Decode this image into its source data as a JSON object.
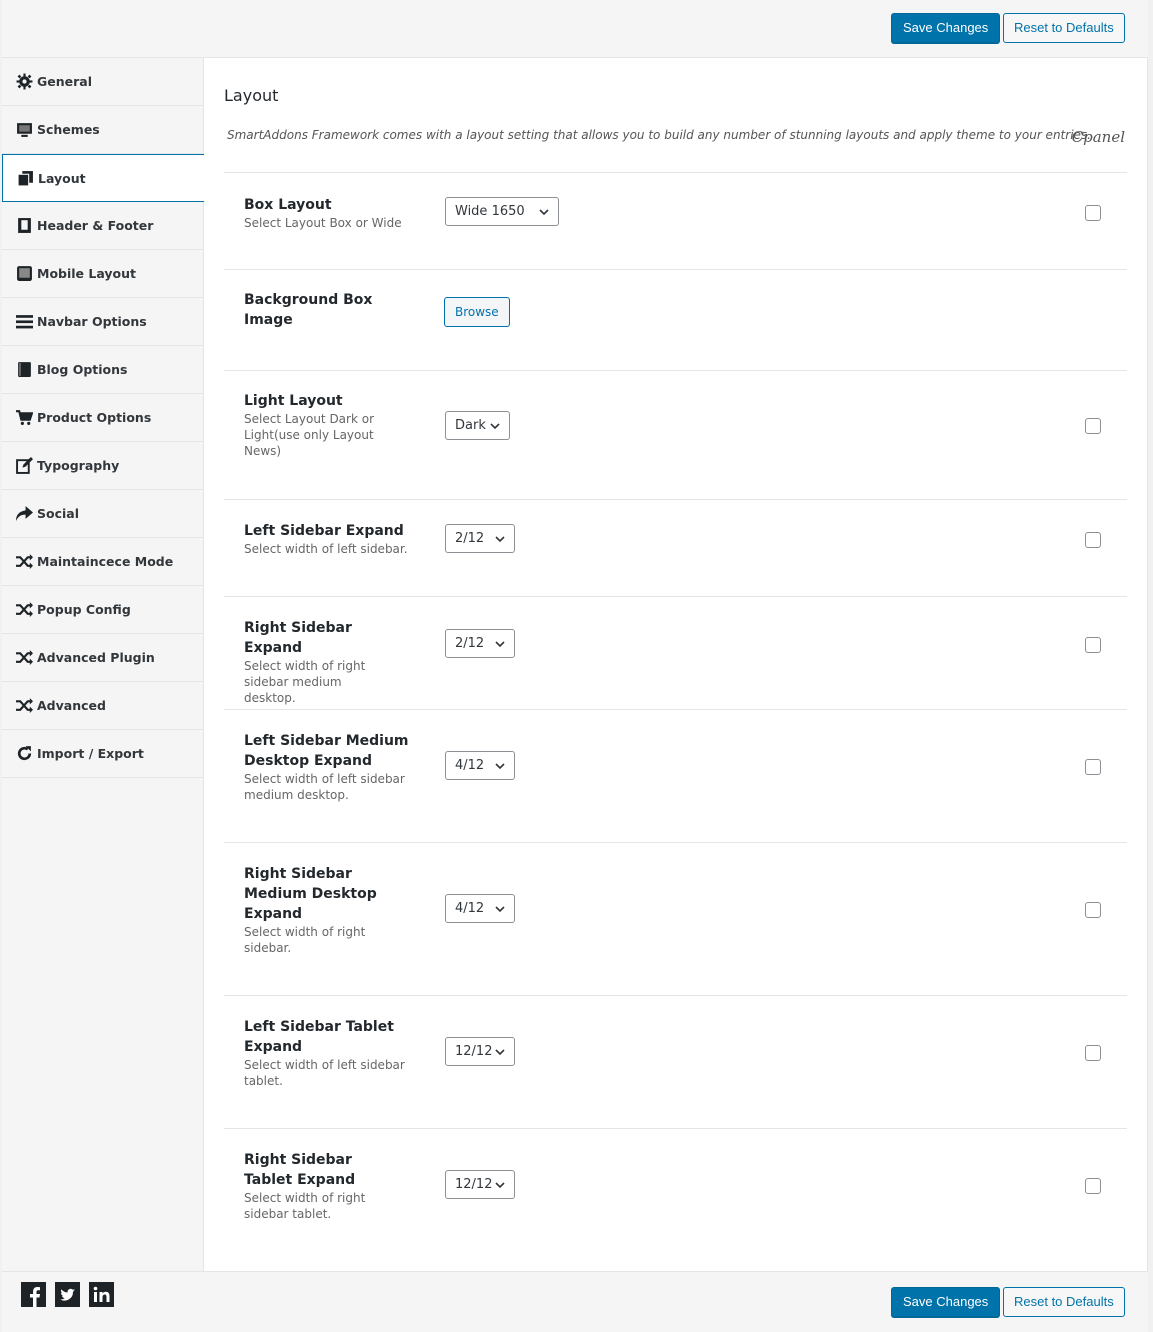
{
  "toolbar": {
    "save_label": "Save Changes",
    "reset_label": "Reset to Defaults"
  },
  "sidebar": {
    "items": [
      {
        "label": "General",
        "icon": "gear-icon"
      },
      {
        "label": "Schemes",
        "icon": "monitor-icon"
      },
      {
        "label": "Layout",
        "icon": "copy-icon",
        "active": true
      },
      {
        "label": "Header & Footer",
        "icon": "book-icon"
      },
      {
        "label": "Mobile Layout",
        "icon": "tablet-icon"
      },
      {
        "label": "Navbar Options",
        "icon": "menu-icon"
      },
      {
        "label": "Blog Options",
        "icon": "book-icon"
      },
      {
        "label": "Product Options",
        "icon": "cart-icon"
      },
      {
        "label": "Typography",
        "icon": "edit-icon"
      },
      {
        "label": "Social",
        "icon": "share-icon"
      },
      {
        "label": "Maintaincece Mode",
        "icon": "shuffle-icon"
      },
      {
        "label": "Popup Config",
        "icon": "shuffle-icon"
      },
      {
        "label": "Advanced Plugin",
        "icon": "shuffle-icon"
      },
      {
        "label": "Advanced",
        "icon": "shuffle-icon"
      },
      {
        "label": "Import / Export",
        "icon": "refresh-icon"
      }
    ]
  },
  "main": {
    "title": "Layout",
    "description": "SmartAddons Framework comes with a layout setting that allows you to build any number of stunning layouts and apply theme to your entries.",
    "cpanel": "Cpanel",
    "fields": [
      {
        "title": "Box Layout",
        "desc": "Select Layout Box or Wide",
        "value": "Wide 1650",
        "type": "select"
      },
      {
        "title": "Background Box Image",
        "desc": "",
        "value": "Browse",
        "type": "browse"
      },
      {
        "title": "Light Layout",
        "desc": "Select Layout Dark or Light(use only Layout News)",
        "value": "Dark",
        "type": "select"
      },
      {
        "title": "Left Sidebar Expand",
        "desc": "Select width of left sidebar.",
        "value": "2/12",
        "type": "select"
      },
      {
        "title": "Right Sidebar Expand",
        "desc": "Select width of right sidebar medium desktop.",
        "value": "2/12",
        "type": "select"
      },
      {
        "title": "Left Sidebar Medium Desktop Expand",
        "desc": "Select width of left sidebar medium desktop.",
        "value": "4/12",
        "type": "select"
      },
      {
        "title": "Right Sidebar Medium Desktop Expand",
        "desc": "Select width of right sidebar.",
        "value": "4/12",
        "type": "select"
      },
      {
        "title": "Left Sidebar Tablet Expand",
        "desc": "Select width of left sidebar tablet.",
        "value": "12/12",
        "type": "select"
      },
      {
        "title": "Right Sidebar Tablet Expand",
        "desc": "Select width of right sidebar tablet.",
        "value": "12/12",
        "type": "select"
      }
    ]
  },
  "footer": {
    "social": [
      "facebook-icon",
      "twitter-icon",
      "linkedin-icon"
    ]
  },
  "colors": {
    "accent": "#0073aa",
    "border": "#e5e5e5"
  }
}
